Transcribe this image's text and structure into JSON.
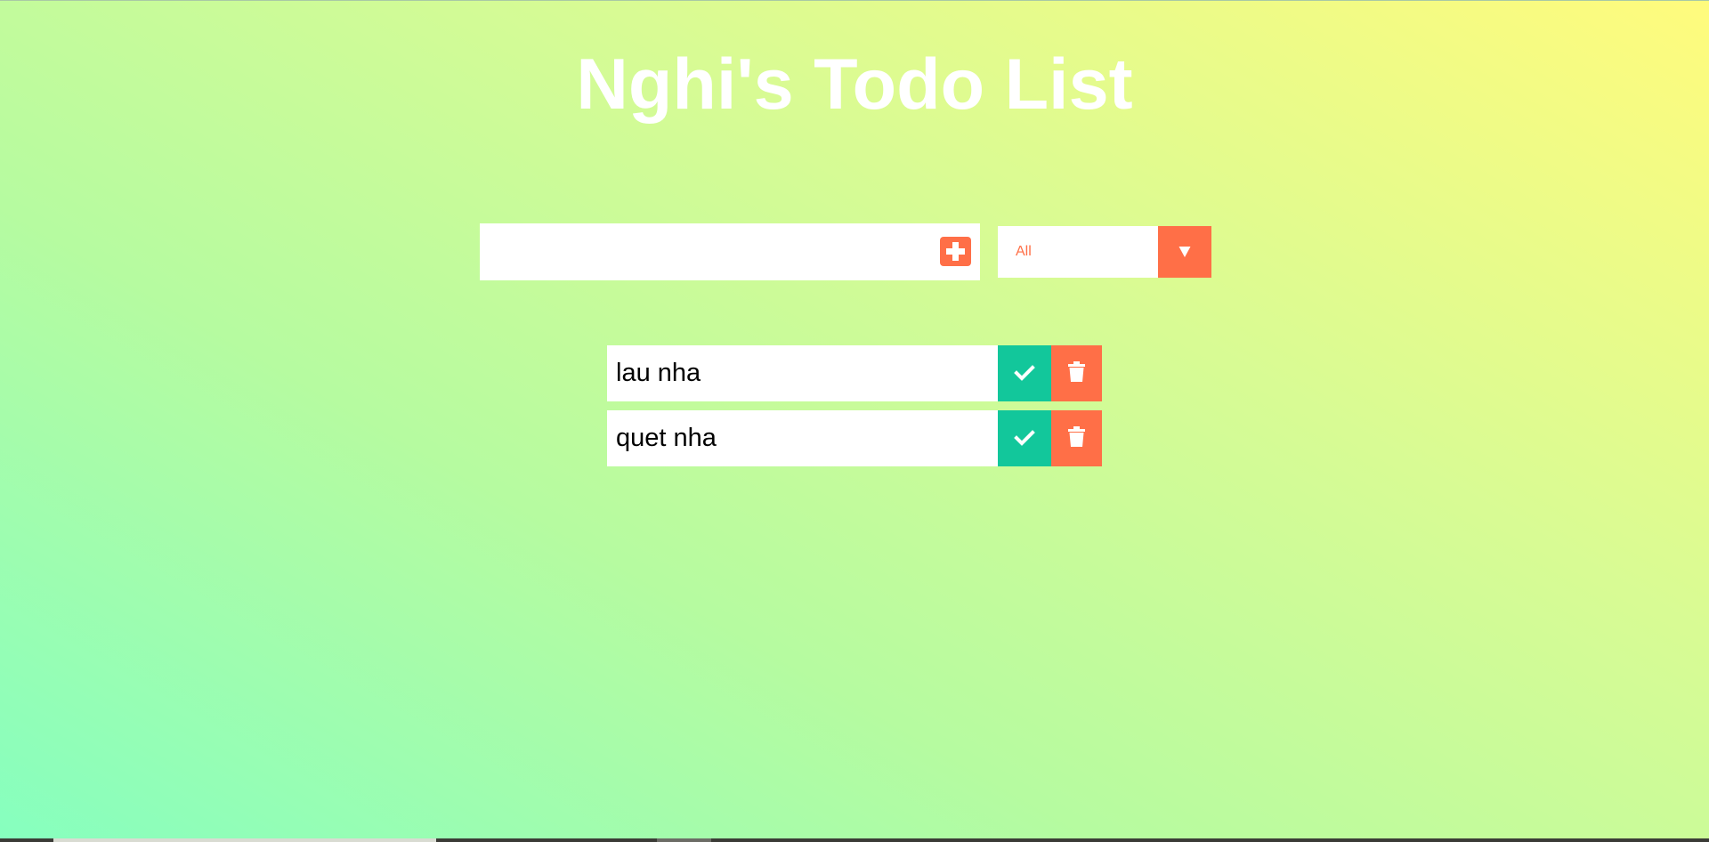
{
  "header": {
    "title": "Nghi's Todo List"
  },
  "form": {
    "input_value": "",
    "input_placeholder": "",
    "add_icon": "plus-square-icon",
    "filter": {
      "selected": "All",
      "dropdown_icon": "caret-down-icon",
      "dropdown_glyph": "▼"
    }
  },
  "todos": [
    {
      "text": "lau nha",
      "complete_icon": "check-icon",
      "delete_icon": "trash-icon"
    },
    {
      "text": "quet nha",
      "complete_icon": "check-icon",
      "delete_icon": "trash-icon"
    }
  ],
  "colors": {
    "accent": "#ff6f47",
    "complete": "#12c79b",
    "gradient_start": "#86ffbf",
    "gradient_end": "#fffb7d",
    "title": "#ffffff"
  }
}
